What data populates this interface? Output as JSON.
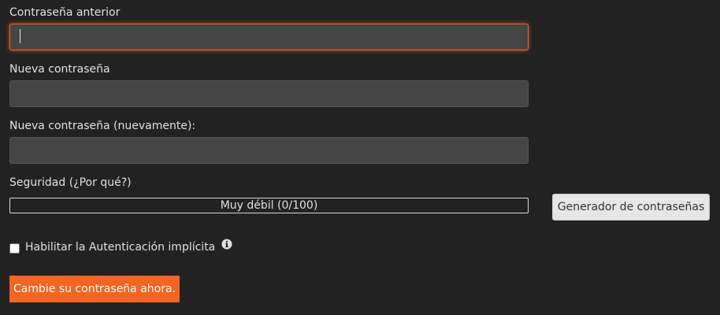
{
  "form": {
    "old_password": {
      "label": "Contraseña anterior",
      "value": ""
    },
    "new_password": {
      "label": "Nueva contraseña",
      "value": ""
    },
    "new_password_repeat": {
      "label": "Nueva contraseña (nuevamente):",
      "value": ""
    },
    "strength": {
      "label": "Seguridad (¿Por qué?)",
      "text": "Muy débil (0/100)",
      "score": 0,
      "max": 100
    },
    "generator_button_label": "Generador de contraseñas",
    "implicit_auth": {
      "label": "Habilitar la Autenticación implícita",
      "checked": false,
      "info_icon": "info-circle-icon"
    },
    "submit_button_label": "Cambie su contraseña ahora."
  },
  "colors": {
    "background": "#222222",
    "field_background": "#454545",
    "accent": "#f26522",
    "secondary_button": "#e6e6e6"
  }
}
